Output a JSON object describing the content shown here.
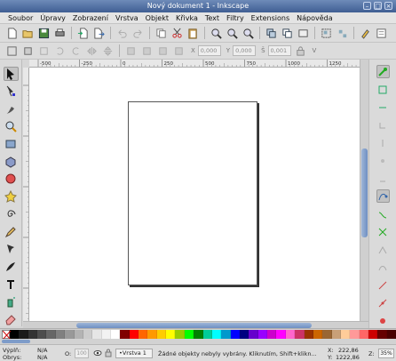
{
  "window": {
    "title": "Nový dokument 1 - Inkscape",
    "buttons": [
      "–",
      "□",
      "×"
    ]
  },
  "menu": [
    {
      "label": "Soubor"
    },
    {
      "label": "Úpravy"
    },
    {
      "label": "Zobrazení"
    },
    {
      "label": "Vrstva"
    },
    {
      "label": "Objekt"
    },
    {
      "label": "Křivka"
    },
    {
      "label": "Text"
    },
    {
      "label": "Filtry"
    },
    {
      "label": "Extensions"
    },
    {
      "label": "Nápověda"
    }
  ],
  "controls": {
    "x_label": "X",
    "x_value": "0,000",
    "y_label": "Y",
    "y_value": "0,000",
    "w_label": "Š",
    "w_value": "0,001",
    "h_label": "V"
  },
  "rulers": {
    "h_ticks": [
      "-500",
      "-250",
      "0",
      "250",
      "500",
      "750",
      "1000",
      "1250"
    ],
    "v_ticks": [
      "0",
      "250",
      "500",
      "750",
      "1000"
    ]
  },
  "palette": {
    "colors": [
      "#000000",
      "#1a1a1a",
      "#333333",
      "#4d4d4d",
      "#666666",
      "#808080",
      "#999999",
      "#b3b3b3",
      "#cccccc",
      "#e6e6e6",
      "#f2f2f2",
      "#ffffff",
      "#800000",
      "#ff0000",
      "#ff6600",
      "#ff9900",
      "#ffcc00",
      "#ffff00",
      "#99cc00",
      "#00ff00",
      "#008000",
      "#00cc99",
      "#00ffff",
      "#0099cc",
      "#0000ff",
      "#000080",
      "#6600cc",
      "#9900ff",
      "#cc00cc",
      "#ff00ff",
      "#ff66cc",
      "#cc3366",
      "#993300",
      "#cc6600",
      "#996633",
      "#c8a078",
      "#ffcc99",
      "#ff9999",
      "#ff6666",
      "#cc0000",
      "#660000",
      "#4a0000"
    ]
  },
  "status": {
    "fill_label": "Výplň:",
    "fill_value": "N/A",
    "stroke_label": "Obrys:",
    "stroke_value": "N/A",
    "opacity_label": "O:",
    "opacity_value": "100",
    "layer": "•Vrstva 1",
    "message": "Žádné objekty nebyly vybrány. Kliknutím, Shift+klikn...",
    "x_label": "X:",
    "x_value": "222,86",
    "y_label": "Y:",
    "y_value": "1222,86",
    "zoom_label": "Z:",
    "zoom_value": "35%"
  }
}
